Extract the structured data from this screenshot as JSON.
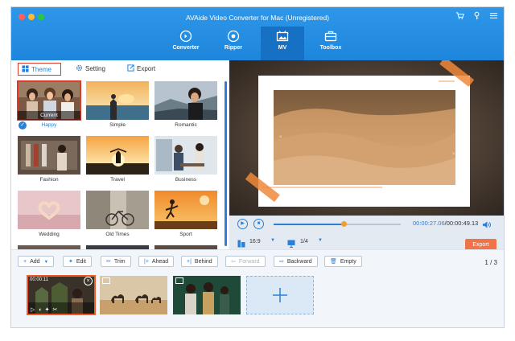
{
  "window": {
    "title": "AVAide Video Converter for Mac (Unregistered)",
    "traffic_colors": [
      "#ff5f57",
      "#febc2e",
      "#28c840"
    ]
  },
  "nav": [
    {
      "label": "Converter",
      "icon": "converter-icon"
    },
    {
      "label": "Ripper",
      "icon": "ripper-icon"
    },
    {
      "label": "MV",
      "icon": "mv-icon",
      "active": true
    },
    {
      "label": "Toolbox",
      "icon": "toolbox-icon"
    }
  ],
  "top_icons": [
    "cart-icon",
    "key-icon",
    "menu-icon"
  ],
  "left_tabs": {
    "theme": "Theme",
    "setting": "Setting",
    "export": "Export"
  },
  "themes": [
    {
      "name": "Happy",
      "badge": "Current",
      "selected": true
    },
    {
      "name": "Simple"
    },
    {
      "name": "Romantic"
    },
    {
      "name": "Fashion"
    },
    {
      "name": "Travel"
    },
    {
      "name": "Business"
    },
    {
      "name": "Wedding"
    },
    {
      "name": "Old Times"
    },
    {
      "name": "Sport"
    }
  ],
  "player": {
    "current_time": "00:00:27.06",
    "total_time": "/00:00:49.13",
    "progress": 0.55,
    "aspect": "16:9",
    "zoom": "1/4",
    "export_label": "Export"
  },
  "toolbar": {
    "add": "Add",
    "edit": "Edit",
    "trim": "Trim",
    "ahead": "Ahead",
    "behind": "Behind",
    "forward": "Forward",
    "backward": "Backward",
    "empty": "Empty",
    "page": "1 / 3"
  },
  "clips": [
    {
      "duration": "00:00:11",
      "selected": true
    },
    {
      "duration": ""
    },
    {
      "duration": ""
    }
  ],
  "colors": {
    "accent": "#2b7fd6",
    "titlebar": "#2f97e9",
    "export": "#f0734a",
    "highlight": "#e0392b"
  }
}
